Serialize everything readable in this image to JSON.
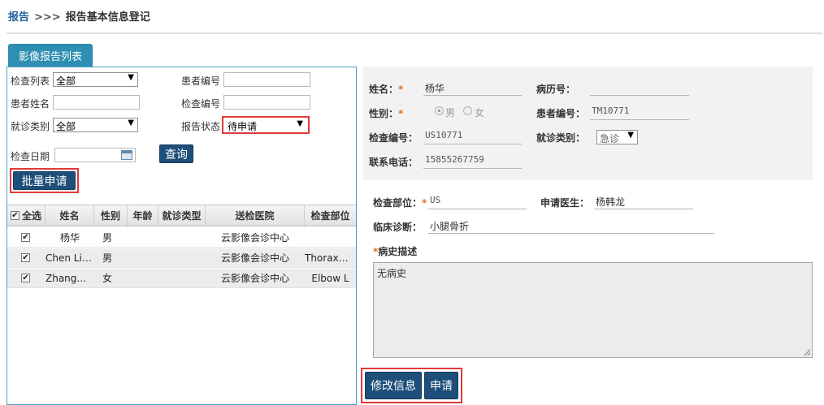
{
  "breadcrumb": {
    "root": "报告",
    "separator": ">>>",
    "current": "报告基本信息登记"
  },
  "tab": {
    "label": "影像报告列表"
  },
  "filters": {
    "exam_list_label": "检查列表",
    "exam_list_value": "全部",
    "patient_no_label": "患者编号",
    "patient_name_label": "患者姓名",
    "exam_no_label": "检查编号",
    "visit_type_label": "就诊类别",
    "visit_type_value": "全部",
    "report_status_label": "报告状态",
    "report_status_value": "待申请",
    "exam_date_label": "检查日期",
    "query_button": "查询",
    "batch_apply_button": "批量申请"
  },
  "table": {
    "columns": [
      "全选",
      "姓名",
      "性别",
      "年龄",
      "就诊类型",
      "送检医院",
      "检查部位"
    ],
    "rows": [
      {
        "checked": true,
        "name": "杨华",
        "sex": "男",
        "age": "",
        "visit_type": "",
        "hospital": "云影像会诊中心",
        "part": ""
      },
      {
        "checked": true,
        "name": "Chen Li ...",
        "sex": "男",
        "age": "",
        "visit_type": "",
        "hospital": "云影像会诊中心",
        "part": "Thorax^..."
      },
      {
        "checked": true,
        "name": "Zhang^T...",
        "sex": "女",
        "age": "",
        "visit_type": "",
        "hospital": "云影像会诊中心",
        "part": "Elbow L"
      }
    ]
  },
  "form": {
    "name_label": "姓名：",
    "name_value": "杨华",
    "record_no_label": "病历号：",
    "record_no_value": "",
    "sex_label": "性别：",
    "sex_male": "男",
    "sex_female": "女",
    "sex_selected": "男",
    "patient_no_label": "患者编号：",
    "patient_no_value": "TM10771",
    "exam_no_label": "检查编号：",
    "exam_no_value": "US10771",
    "visit_type_label": "就诊类别：",
    "visit_type_value": "急诊",
    "phone_label": "联系电话：",
    "phone_value": "15855267759",
    "exam_part_label": "检查部位：",
    "exam_part_value": "US",
    "doctor_label": "申请医生：",
    "doctor_value": "杨韩龙",
    "diagnosis_label": "临床诊断：",
    "diagnosis_value": "小腿骨折",
    "history_label": "病史描述",
    "history_value": "无病史",
    "required_mark": "*"
  },
  "actions": {
    "modify_button": "修改信息",
    "apply_button": "申请"
  },
  "colors": {
    "navy_button": "#1e4f7a",
    "tab_blue": "#2e8fb2",
    "highlight_red": "#e03a3a",
    "required_orange": "#e07020"
  }
}
